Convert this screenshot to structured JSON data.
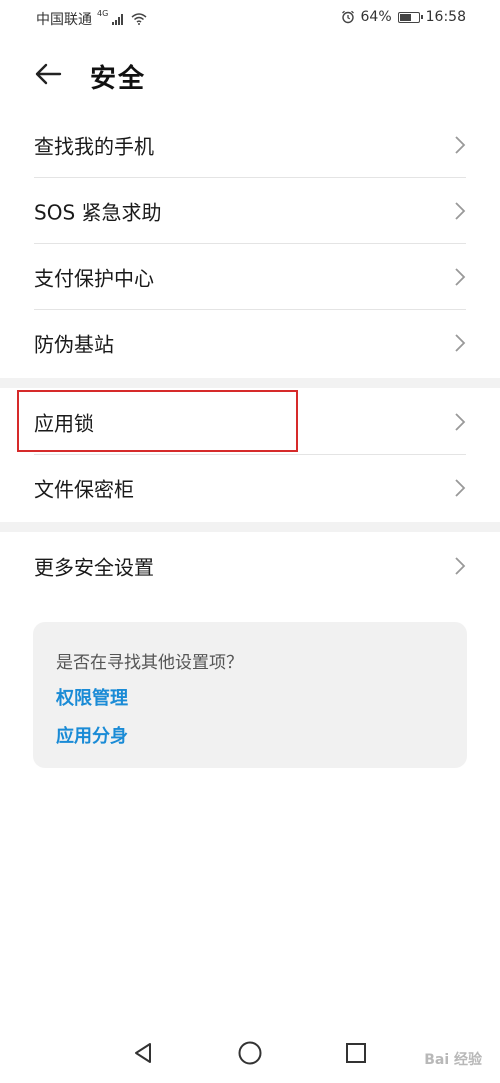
{
  "status_bar": {
    "carrier": "中国联通",
    "network_type": "4G",
    "battery_percent": "64%",
    "time": "16:58",
    "battery_level": 0.64
  },
  "header": {
    "title": "安全"
  },
  "group1": [
    {
      "label": "查找我的手机"
    },
    {
      "label": "SOS 紧急求助"
    },
    {
      "label": "支付保护中心"
    },
    {
      "label": "防伪基站"
    }
  ],
  "group2": [
    {
      "label": "应用锁"
    },
    {
      "label": "文件保密柜"
    }
  ],
  "group3": [
    {
      "label": "更多安全设置"
    }
  ],
  "suggestion": {
    "question": "是否在寻找其他设置项？",
    "links": [
      "权限管理",
      "应用分身"
    ]
  },
  "watermark": "Bai 经验",
  "colors": {
    "link": "#1a8bd6",
    "highlight": "#d62a2a",
    "divider": "#e4e4e4",
    "band": "#f2f2f2"
  }
}
